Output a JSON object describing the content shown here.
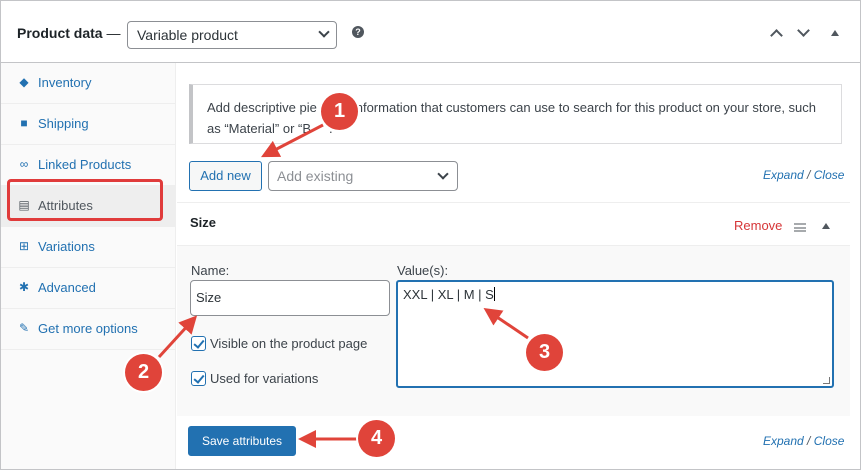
{
  "header": {
    "title": "Product data",
    "dash": "—",
    "product_type": "Variable product",
    "help_icon": "question-icon"
  },
  "sidebar": {
    "items": [
      {
        "label": "Inventory",
        "icon": "tag-icon",
        "glyph": "◆"
      },
      {
        "label": "Shipping",
        "icon": "truck-icon",
        "glyph": "■"
      },
      {
        "label": "Linked Products",
        "icon": "link-icon",
        "glyph": "∞"
      },
      {
        "label": "Attributes",
        "icon": "list-icon",
        "glyph": "▤"
      },
      {
        "label": "Variations",
        "icon": "grid-icon",
        "glyph": "⊞"
      },
      {
        "label": "Advanced",
        "icon": "gear-icon",
        "glyph": "✱"
      },
      {
        "label": "Get more options",
        "icon": "plugin-icon",
        "glyph": "✎"
      }
    ],
    "active": "Attributes"
  },
  "notice": {
    "text_a": "Add descriptive pie",
    "text_b": "information that customers can use to search for this product on your store, such",
    "text_c": "as “Material” or “B",
    "text_d": "."
  },
  "toolbar": {
    "add_new": "Add new",
    "add_existing": "Add existing",
    "expand": "Expand",
    "separator": "/",
    "close": "Close"
  },
  "attribute": {
    "title": "Size",
    "remove": "Remove",
    "name_label": "Name:",
    "name_value": "Size",
    "values_label": "Value(s):",
    "values_value": "XXL | XL | M | S",
    "visible_label": "Visible on the product page",
    "variations_label": "Used for variations"
  },
  "footer": {
    "save": "Save attributes",
    "expand": "Expand",
    "separator": "/",
    "close": "Close"
  },
  "annotations": {
    "badges": [
      "1",
      "2",
      "3",
      "4"
    ],
    "color": "#e0443a"
  },
  "colors": {
    "link": "#2271b1",
    "danger": "#d63638",
    "primary": "#2271b1"
  }
}
